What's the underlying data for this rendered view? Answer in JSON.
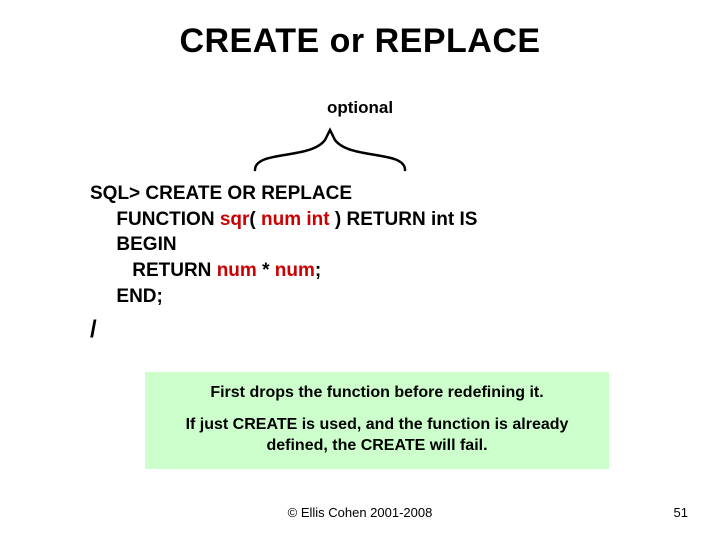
{
  "title": "CREATE or REPLACE",
  "optional_label": "optional",
  "code": {
    "prompt": "SQL>",
    "l1a": " CREATE ",
    "l1b": "OR REPLACE",
    "l2a": "     FUNCTION ",
    "l2b": "sqr",
    "l2c": "( ",
    "l2d": "num",
    "l2e": " ",
    "l2f": "int",
    "l2g": " ) RETURN int IS",
    "l3": "     BEGIN",
    "l4a": "        RETURN ",
    "l4b": "num",
    "l4c": " * ",
    "l4d": "num",
    "l4e": ";",
    "l5": "     END;",
    "slash": "/"
  },
  "note": {
    "line1": "First drops the function before redefining it.",
    "line2": "If just CREATE is used, and the function is already defined, the CREATE will fail."
  },
  "footer": {
    "copyright": "© Ellis Cohen 2001-2008",
    "page": "51"
  }
}
